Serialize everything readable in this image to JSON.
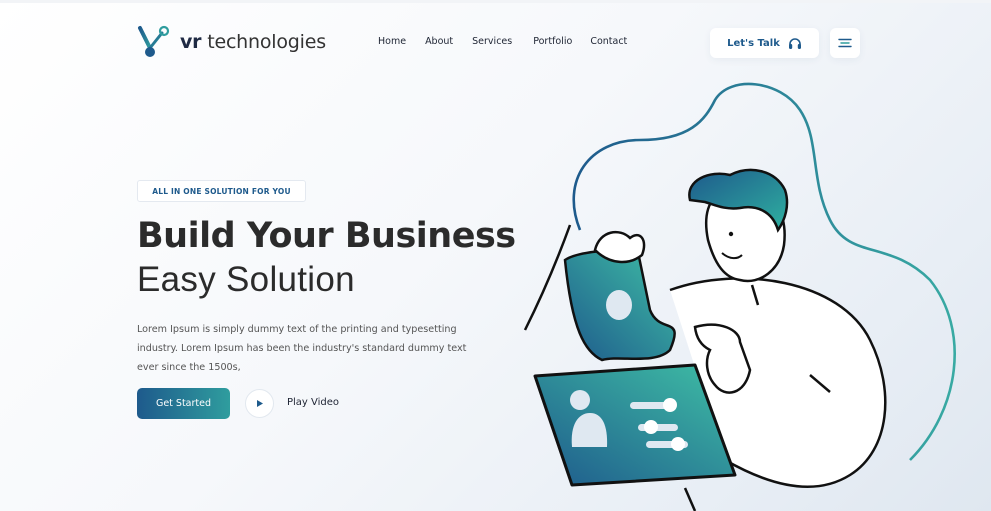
{
  "header": {
    "brand_bold": "vr",
    "brand_rest": " technologies",
    "nav": [
      "Home",
      "About",
      "Services",
      "Portfolio",
      "Contact"
    ],
    "talk_label": "Let's Talk"
  },
  "hero": {
    "badge": "ALL IN ONE SOLUTION FOR YOU",
    "title_line1": "Build Your Business",
    "title_line2": "Easy Solution",
    "description": "Lorem Ipsum is simply dummy text of the printing and typesetting industry. Lorem Ipsum has been the industry's standard dummy text ever since the 1500s,",
    "cta_label": "Get Started",
    "play_label": "Play Video"
  },
  "colors": {
    "brand_blue": "#1e5a8c",
    "brand_teal": "#2f9d9e",
    "text_dark": "#2b2b2b"
  },
  "icons": [
    "logo-icon",
    "headphones-icon",
    "hamburger-menu-icon",
    "play-icon"
  ]
}
